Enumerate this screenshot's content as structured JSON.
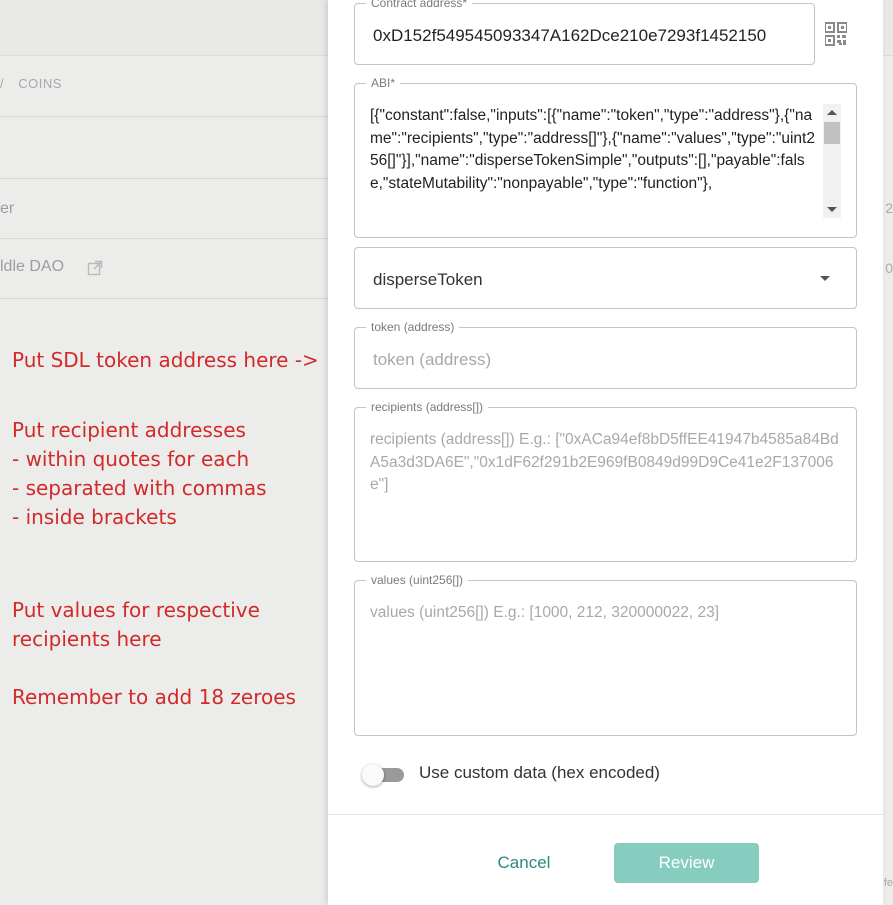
{
  "background": {
    "breadcrumb_sep": "/",
    "breadcrumb_item": "COINS",
    "row1_text": "er",
    "row2_text": "ldle DAO",
    "right_edge_1": "2",
    "right_edge_2": "0",
    "bottom_right_text": "fe"
  },
  "annotations": {
    "token_hint": "Put SDL token address here ->",
    "recipients_hint": [
      "Put recipient addresses",
      "- within quotes for each",
      "- separated with commas",
      "- inside brackets"
    ],
    "values_hint": [
      "Put values for respective",
      "recipients here"
    ],
    "zeroes_hint": "Remember to add 18 zeroes"
  },
  "form": {
    "contract_address": {
      "label": "Contract address*",
      "value": "0xD152f549545093347A162Dce210e7293f1452150"
    },
    "abi": {
      "label": "ABI*",
      "value": "[{\"constant\":false,\"inputs\":[{\"name\":\"token\",\"type\":\"address\"},{\"name\":\"recipients\",\"type\":\"address[]\"},{\"name\":\"values\",\"type\":\"uint256[]\"}],\"name\":\"disperseTokenSimple\",\"outputs\":[],\"payable\":false,\"stateMutability\":\"nonpayable\",\"type\":\"function\"},"
    },
    "method": {
      "selected": "disperseToken"
    },
    "token": {
      "label": "token (address)",
      "placeholder": "token (address)"
    },
    "recipients": {
      "label": "recipients (address[])",
      "placeholder": "recipients (address[]) E.g.: [\"0xACa94ef8bD5ffEE41947b4585a84BdA5a3d3DA6E\",\"0x1dF62f291b2E969fB0849d99D9Ce41e2F137006e\"]"
    },
    "values": {
      "label": "values (uint256[])",
      "placeholder": "values (uint256[]) E.g.: [1000, 212, 320000022, 23]"
    },
    "custom_data": {
      "label": "Use custom data (hex encoded)",
      "enabled": false
    }
  },
  "footer": {
    "cancel_label": "Cancel",
    "review_label": "Review"
  },
  "icons": {
    "qr": "qr-code-icon",
    "external_link": "external-link-icon",
    "dropdown": "chevron-down-icon"
  },
  "colors": {
    "accent": "#2a8a7e",
    "review_button": "#86cdbf",
    "annotation": "#d22a2a"
  }
}
